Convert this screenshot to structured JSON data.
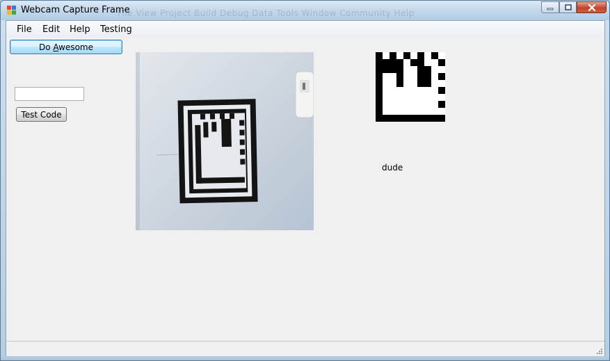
{
  "window": {
    "title": "Webcam Capture Frame",
    "ghost_menu": "File   View   Project   Build   Debug   Data   Tools   Window   Community   Help"
  },
  "menu": [
    {
      "label": "File"
    },
    {
      "label": "Edit"
    },
    {
      "label": "Help"
    },
    {
      "label": "Testing"
    }
  ],
  "controls": {
    "do_awesome_pre": "Do ",
    "do_awesome_mnemonic": "A",
    "do_awesome_post": "wesome",
    "test_code_label": "Test Code",
    "code_input_value": ""
  },
  "output": {
    "result_label": "dude"
  },
  "icons": {
    "app": "app-icon",
    "minimize": "minimize-icon",
    "maximize": "maximize-icon",
    "close": "close-icon",
    "grip": "size-grip-icon"
  },
  "colors": {
    "title_gradient_top": "#d9e8f5",
    "close_red": "#c4452c",
    "client_bg": "#f0f0f0"
  }
}
